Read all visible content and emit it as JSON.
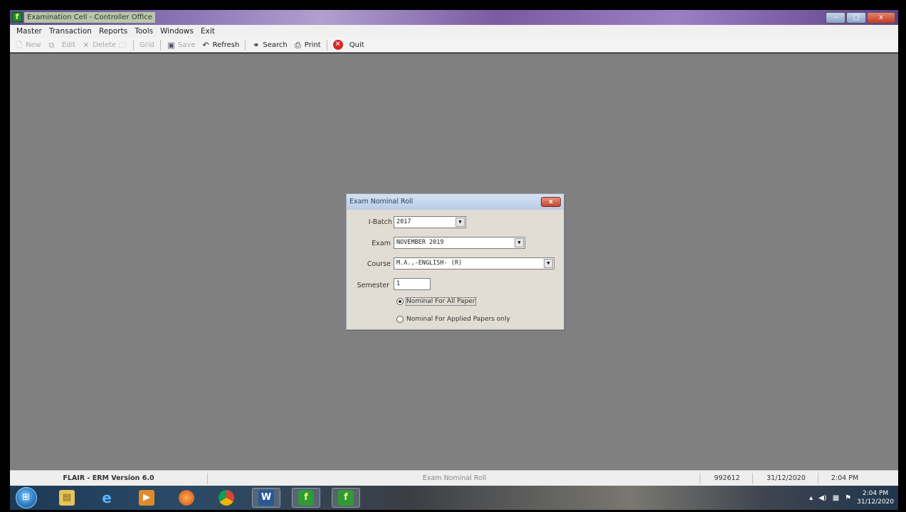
{
  "window": {
    "title": "Examination Cell - Controller Office",
    "controls": {
      "minimize": "–",
      "maximize": "□",
      "close": "x"
    }
  },
  "menu": [
    "Master",
    "Transaction",
    "Reports",
    "Tools",
    "Windows",
    "Exit"
  ],
  "toolbar": {
    "new": "New",
    "edit": "Edit",
    "delete": "Delete",
    "grid": "Grid",
    "save": "Save",
    "refresh": "Refresh",
    "search": "Search",
    "print": "Print",
    "quit": "Quit"
  },
  "dialog": {
    "title": "Exam Nominal Roll",
    "close": "x",
    "batch_label": "I-Batch",
    "batch_value": "2017",
    "exam_label": "Exam",
    "exam_value": "NOVEMBER 2019",
    "course_label": "Course",
    "course_value": "M.A.,-ENGLISH- (R)",
    "semester_label": "Semester",
    "semester_value": "1",
    "radio_all": "Nominal For All Paper",
    "radio_applied": "Nominal For Applied Papers only",
    "selected": "all"
  },
  "statusbar": {
    "version": "FLAIR - ERM Version 6.0",
    "form": "Exam Nominal Roll",
    "user_code": "992612",
    "date": "31/12/2020",
    "time": "2:04 PM"
  },
  "taskbar": {
    "clock_time": "2:04 PM",
    "clock_date": "31/12/2020",
    "apps": [
      "explorer-icon",
      "internet-explorer-icon",
      "media-player-icon",
      "firefox-icon",
      "chrome-icon",
      "word-icon",
      "flair-app-icon",
      "flair-app-icon"
    ]
  }
}
